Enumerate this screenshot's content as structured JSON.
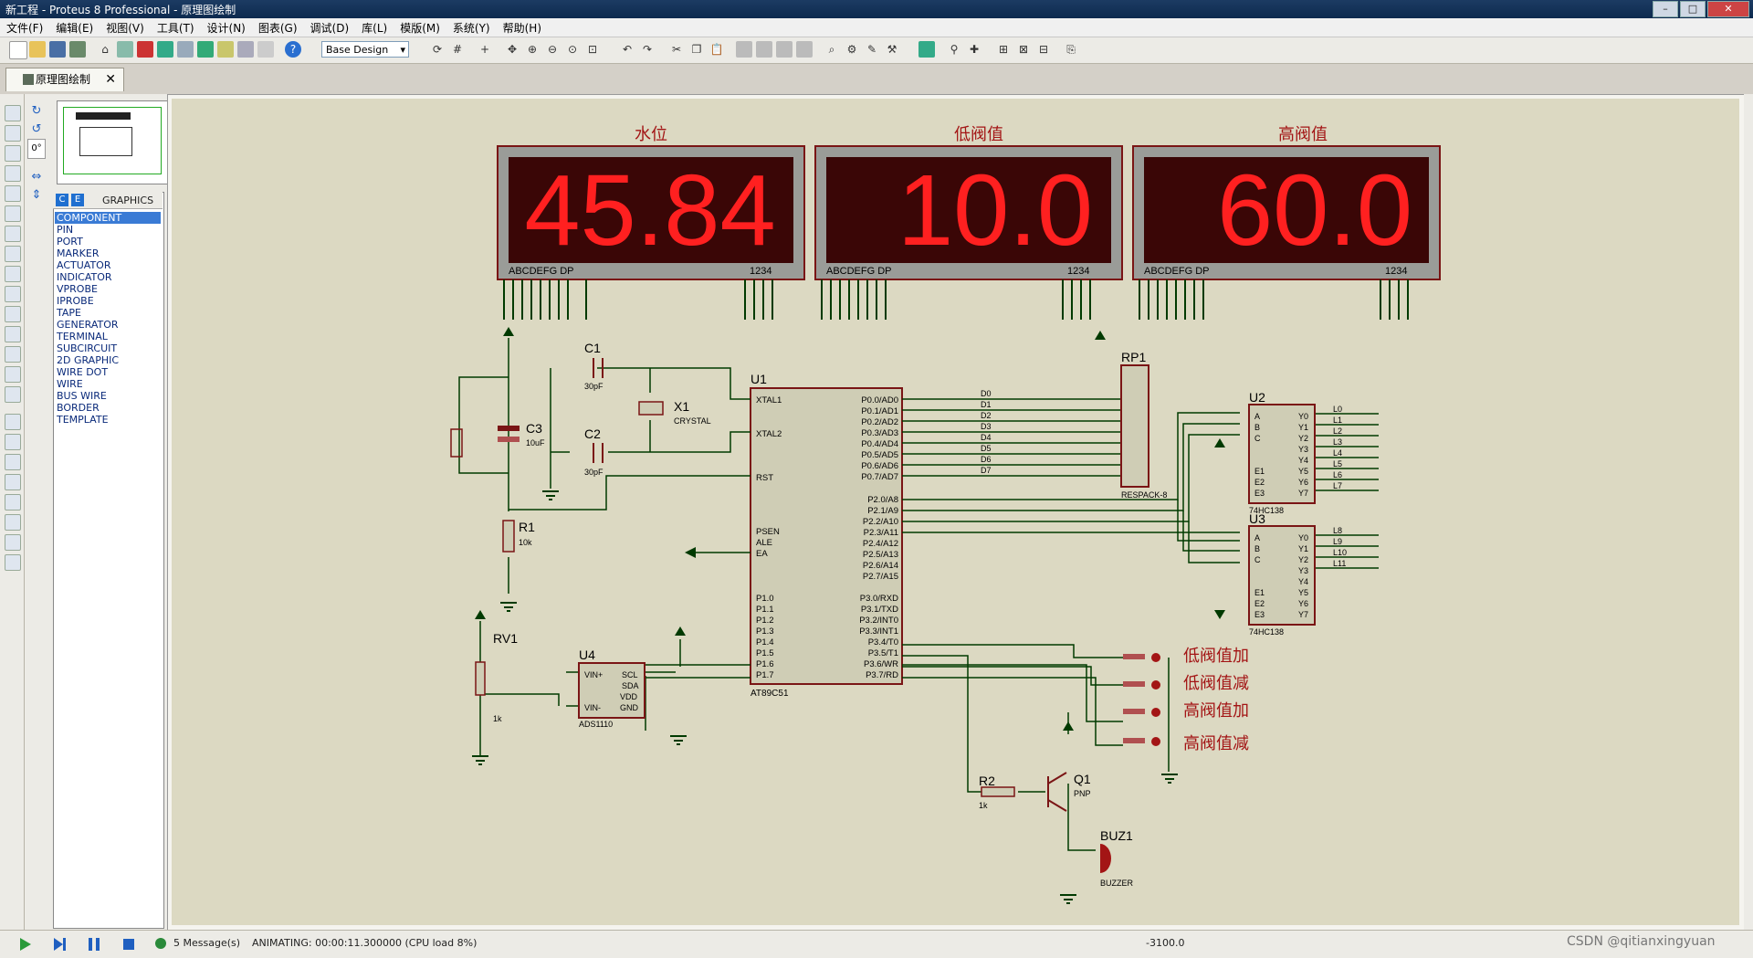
{
  "window": {
    "title": "新工程 - Proteus 8 Professional - 原理图绘制"
  },
  "menu": [
    "文件(F)",
    "编辑(E)",
    "视图(V)",
    "工具(T)",
    "设计(N)",
    "图表(G)",
    "调试(D)",
    "库(L)",
    "模版(M)",
    "系统(Y)",
    "帮助(H)"
  ],
  "toolbar": {
    "design_select": "Base Design"
  },
  "tab": {
    "label": "原理图绘制"
  },
  "side": {
    "mode_header": "GRAPHICS",
    "angle_value": "0°",
    "items": [
      "COMPONENT",
      "PIN",
      "PORT",
      "MARKER",
      "ACTUATOR",
      "INDICATOR",
      "VPROBE",
      "IPROBE",
      "TAPE",
      "GENERATOR",
      "TERMINAL",
      "SUBCIRCUIT",
      "2D GRAPHIC",
      "WIRE DOT",
      "WIRE",
      "BUS WIRE",
      "BORDER",
      "TEMPLATE"
    ],
    "selected": 0
  },
  "displays": [
    {
      "title": "水位",
      "value": "45.84"
    },
    {
      "title": "低阀值",
      "value": "10.0"
    },
    {
      "title": "高阀值",
      "value": "60.0"
    }
  ],
  "display_pins": {
    "segments": "ABCDEFG DP",
    "digits": "1234"
  },
  "components": {
    "c1": "C1",
    "c1_val": "30pF",
    "c2": "C2",
    "c2_val": "30pF",
    "c3": "C3",
    "c3_val": "10uF",
    "x1": "X1",
    "x1_val": "CRYSTAL",
    "r1": "R1",
    "r1_val": "10k",
    "rv1": "RV1",
    "rv1_val": "1k",
    "u1": "U1",
    "u1_part": "AT89C51",
    "u4": "U4",
    "u4_part": "ADS1110",
    "rp1": "RP1",
    "rp1_part": "RESPACK-8",
    "u2": "U2",
    "u3": "U3",
    "hc138": "74HC138",
    "r2": "R2",
    "r2_val": "1k",
    "q1": "Q1",
    "q1_part": "PNP",
    "buz1": "BUZ1",
    "buz1_part": "BUZZER"
  },
  "u1_left_pins": [
    "XTAL1",
    "XTAL2",
    "RST",
    "PSEN",
    "ALE",
    "EA",
    "P1.0",
    "P1.1",
    "P1.2",
    "P1.3",
    "P1.4",
    "P1.5",
    "P1.6",
    "P1.7"
  ],
  "u1_right_pins": [
    "P0.0/AD0",
    "P0.1/AD1",
    "P0.2/AD2",
    "P0.3/AD3",
    "P0.4/AD4",
    "P0.5/AD5",
    "P0.6/AD6",
    "P0.7/AD7",
    "P2.0/A8",
    "P2.1/A9",
    "P2.2/A10",
    "P2.3/A11",
    "P2.4/A12",
    "P2.5/A13",
    "P2.6/A14",
    "P2.7/A15",
    "P3.0/RXD",
    "P3.1/TXD",
    "P3.2/INT0",
    "P3.3/INT1",
    "P3.4/T0",
    "P3.5/T1",
    "P3.6/WR",
    "P3.7/RD"
  ],
  "data_labels": [
    "D0",
    "D1",
    "D2",
    "D3",
    "D4",
    "D5",
    "D6",
    "D7"
  ],
  "u2_outputs": [
    "L0",
    "L1",
    "L2",
    "L3",
    "L4",
    "L5",
    "L6",
    "L7"
  ],
  "u3_outputs": [
    "L8",
    "L9",
    "L10",
    "L11"
  ],
  "buttons": [
    "低阀值加",
    "低阀值减",
    "高阀值加",
    "高阀值减"
  ],
  "status": {
    "messages": "5 Message(s)",
    "animating": "ANIMATING: 00:00:11.300000 (CPU load 8%)",
    "coord": "-3100.0",
    "watermark": "CSDN @qitianxingyuan"
  }
}
